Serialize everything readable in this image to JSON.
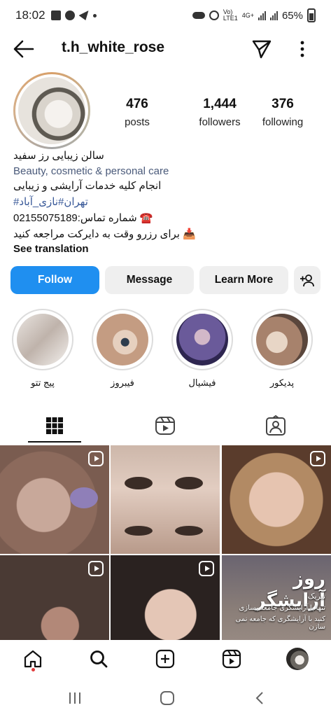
{
  "status": {
    "time": "18:02",
    "battery": "65%",
    "network": "4G+"
  },
  "header": {
    "username": "t.h_white_rose"
  },
  "profile": {
    "stats": [
      {
        "num": "476",
        "label": "posts"
      },
      {
        "num": "1,444",
        "label": "followers"
      },
      {
        "num": "376",
        "label": "following"
      }
    ],
    "bio": {
      "name": "سالن زیبایی رز سفید",
      "category": "Beauty, cosmetic & personal care",
      "line1": "انجام کلیه خدمات آرایشی و زیبایی",
      "tags": "تهران#نازی_آباد#",
      "phone": "☎️ شماره تماس:02155075189",
      "booking": "📥 برای رزرو وقت به دایرکت مراجعه کنید",
      "see_translation": "See translation"
    }
  },
  "buttons": {
    "follow": "Follow",
    "message": "Message",
    "learn_more": "Learn More"
  },
  "highlights": [
    {
      "label": "پیج تتو",
      "color": "#cfc4bd"
    },
    {
      "label": "فیبروز",
      "color": "#c8a68c"
    },
    {
      "label": "فیشیال",
      "color": "#6a5a9a"
    },
    {
      "label": "پدیکور",
      "color": "#b89a86"
    }
  ],
  "grid": {
    "overlay_title": "روز آرایشگر",
    "overlay_sub": "تبریک",
    "overlay_lines": [
      "تنها با آرایشگری جامعه بسازی",
      "کنید با آرایشگری که جامعه نمی سازن"
    ]
  }
}
